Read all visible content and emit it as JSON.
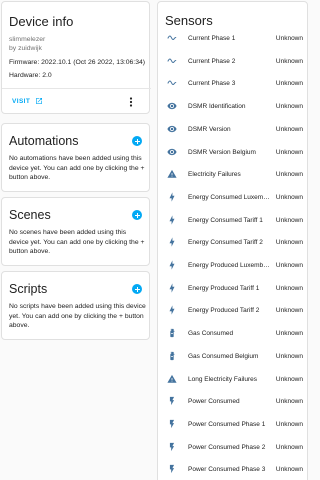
{
  "device_info": {
    "title": "Device info",
    "name": "slimmelezer",
    "by": "by zuidwijk",
    "firmware": "Firmware: 2022.10.1 (Oct 26 2022, 13:06:34)",
    "hardware": "Hardware: 2.0",
    "visit_label": "VISIT"
  },
  "automations": {
    "title": "Automations",
    "empty_text": "No automations have been added using this device yet. You can add one by clicking the + button above."
  },
  "scenes": {
    "title": "Scenes",
    "empty_text": "No scenes have been added using this device yet. You can add one by clicking the + button above."
  },
  "scripts": {
    "title": "Scripts",
    "empty_text": "No scripts have been added using this device yet. You can add one by clicking the + button above."
  },
  "sensors": {
    "title": "Sensors",
    "items": [
      {
        "name": "Current Phase 1",
        "state": "Unknown",
        "icon": "sine-wave-icon"
      },
      {
        "name": "Current Phase 2",
        "state": "Unknown",
        "icon": "sine-wave-icon"
      },
      {
        "name": "Current Phase 3",
        "state": "Unknown",
        "icon": "sine-wave-icon"
      },
      {
        "name": "DSMR Identification",
        "state": "Unknown",
        "icon": "eye-icon"
      },
      {
        "name": "DSMR Version",
        "state": "Unknown",
        "icon": "eye-icon"
      },
      {
        "name": "DSMR Version Belgium",
        "state": "Unknown",
        "icon": "eye-icon"
      },
      {
        "name": "Electricity Failures",
        "state": "Unknown",
        "icon": "alert-icon"
      },
      {
        "name": "Energy Consumed Luxem…",
        "state": "Unknown",
        "icon": "lightning-icon"
      },
      {
        "name": "Energy Consumed Tariff 1",
        "state": "Unknown",
        "icon": "lightning-icon"
      },
      {
        "name": "Energy Consumed Tariff 2",
        "state": "Unknown",
        "icon": "lightning-icon"
      },
      {
        "name": "Energy Produced Luxemb…",
        "state": "Unknown",
        "icon": "lightning-icon"
      },
      {
        "name": "Energy Produced Tariff 1",
        "state": "Unknown",
        "icon": "lightning-icon"
      },
      {
        "name": "Energy Produced Tariff 2",
        "state": "Unknown",
        "icon": "lightning-icon"
      },
      {
        "name": "Gas Consumed",
        "state": "Unknown",
        "icon": "gas-cylinder-icon"
      },
      {
        "name": "Gas Consumed Belgium",
        "state": "Unknown",
        "icon": "gas-cylinder-icon"
      },
      {
        "name": "Long Electricity Failures",
        "state": "Unknown",
        "icon": "alert-icon"
      },
      {
        "name": "Power Consumed",
        "state": "Unknown",
        "icon": "flash-icon"
      },
      {
        "name": "Power Consumed Phase 1",
        "state": "Unknown",
        "icon": "flash-icon"
      },
      {
        "name": "Power Consumed Phase 2",
        "state": "Unknown",
        "icon": "flash-icon"
      },
      {
        "name": "Power Consumed Phase 3",
        "state": "Unknown",
        "icon": "flash-icon"
      }
    ]
  },
  "colors": {
    "icon": "#44739e",
    "accent": "#03a9f4",
    "muted": "#727272"
  }
}
